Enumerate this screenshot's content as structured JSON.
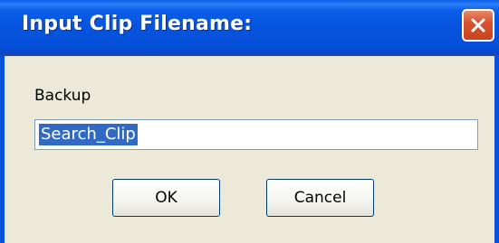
{
  "dialog": {
    "title": "Input Clip Filename:",
    "prompt": "Backup",
    "input_value": "Search_Clip",
    "ok_label": "OK",
    "cancel_label": "Cancel"
  },
  "icons": {
    "close": "close-icon"
  },
  "colors": {
    "titlebar": "#0754df",
    "close_button": "#d8542f",
    "selection": "#316ac5",
    "dialog_background": "#ECE9D8"
  }
}
